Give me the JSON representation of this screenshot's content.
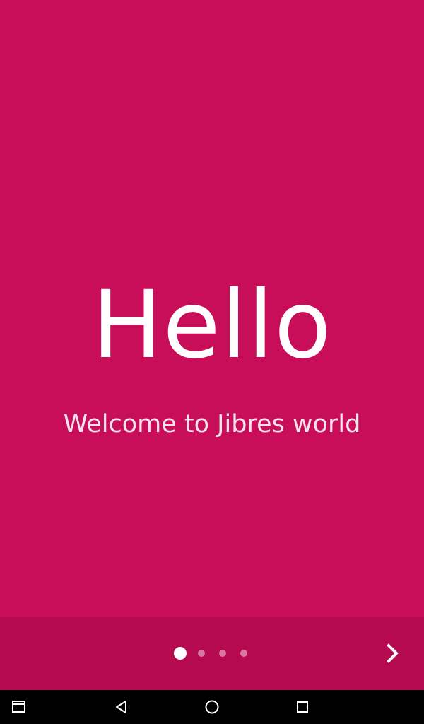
{
  "welcome": {
    "title": "Hello",
    "subtitle": "Welcome to Jibres world"
  },
  "pager": {
    "pages": 4,
    "current_page": 1
  },
  "colors": {
    "background": "#c80d59",
    "pager_bar": "#b60a50",
    "text": "#ffffff"
  },
  "icons": {
    "next": "chevron-right-icon",
    "recents": "window-icon",
    "back": "back-triangle-icon",
    "home": "home-circle-icon",
    "overview": "overview-square-icon"
  }
}
